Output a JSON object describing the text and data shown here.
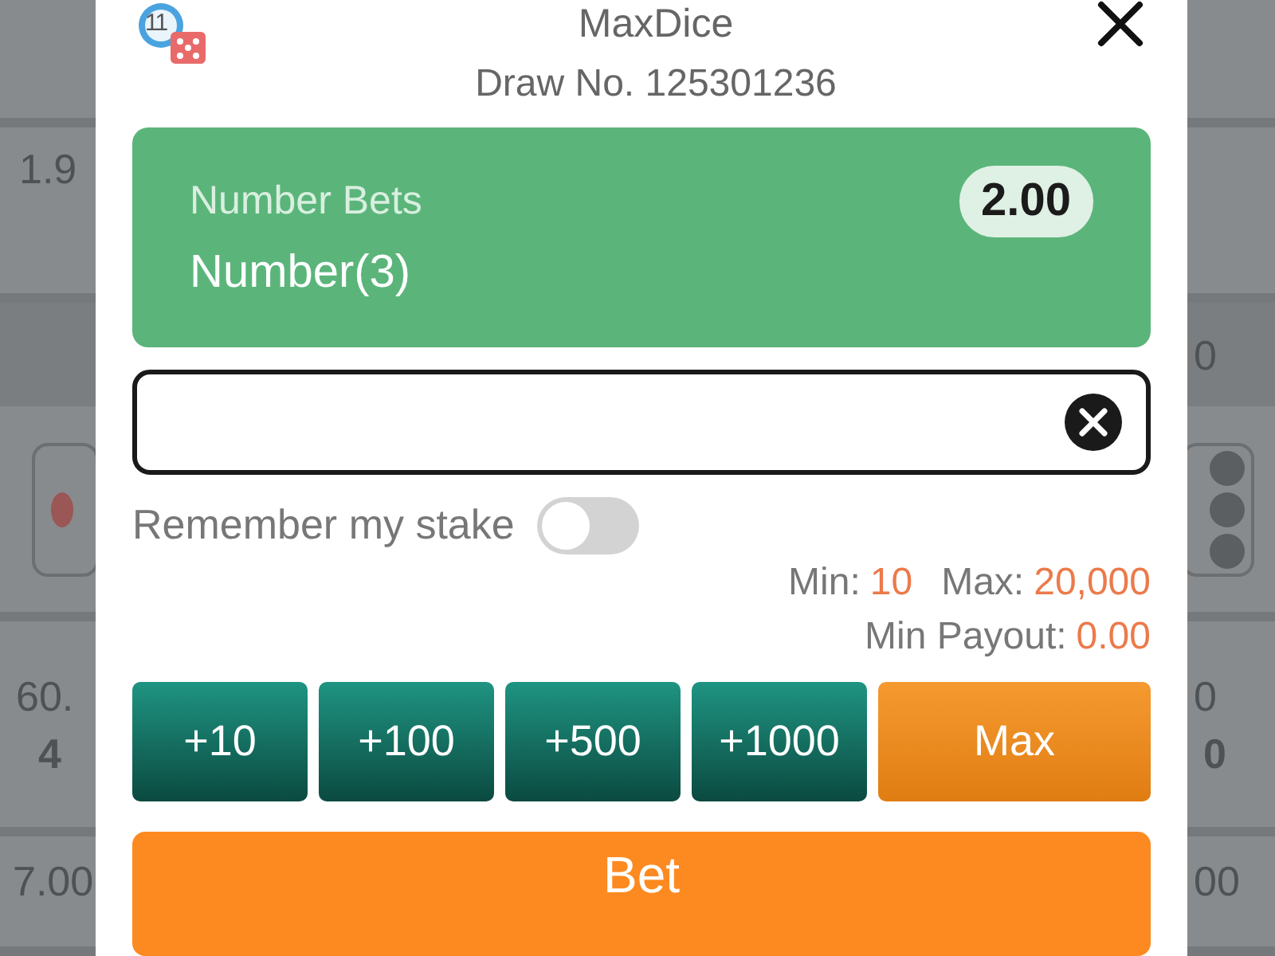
{
  "backdrop": {
    "left": {
      "cell_1": "1.9",
      "cell_2": "60.",
      "cell_2_sub": "4",
      "cell_3": "7.00"
    },
    "right": {
      "band": "0",
      "cell_2": "0",
      "cell_2_sub": "0",
      "cell_3": "00"
    }
  },
  "dialog": {
    "logo_number": "11",
    "title": "MaxDice",
    "draw": "Draw No. 125301236",
    "bet_card": {
      "type_label": "Number Bets",
      "selection": "Number(3)",
      "odds": "2.00"
    },
    "remember": {
      "label": "Remember my stake",
      "on": false
    },
    "limits": [
      {
        "label": "Min:",
        "value": "10"
      },
      {
        "label": "Max:",
        "value": "20,000"
      }
    ],
    "min_payout": {
      "label": "Min Payout:",
      "value": "0.00"
    },
    "chips": [
      {
        "label": "+10",
        "kind": "add"
      },
      {
        "label": "+100",
        "kind": "add"
      },
      {
        "label": "+500",
        "kind": "add"
      },
      {
        "label": "+1000",
        "kind": "add"
      },
      {
        "label": "Max",
        "kind": "max"
      }
    ],
    "bet_button": "Bet"
  }
}
